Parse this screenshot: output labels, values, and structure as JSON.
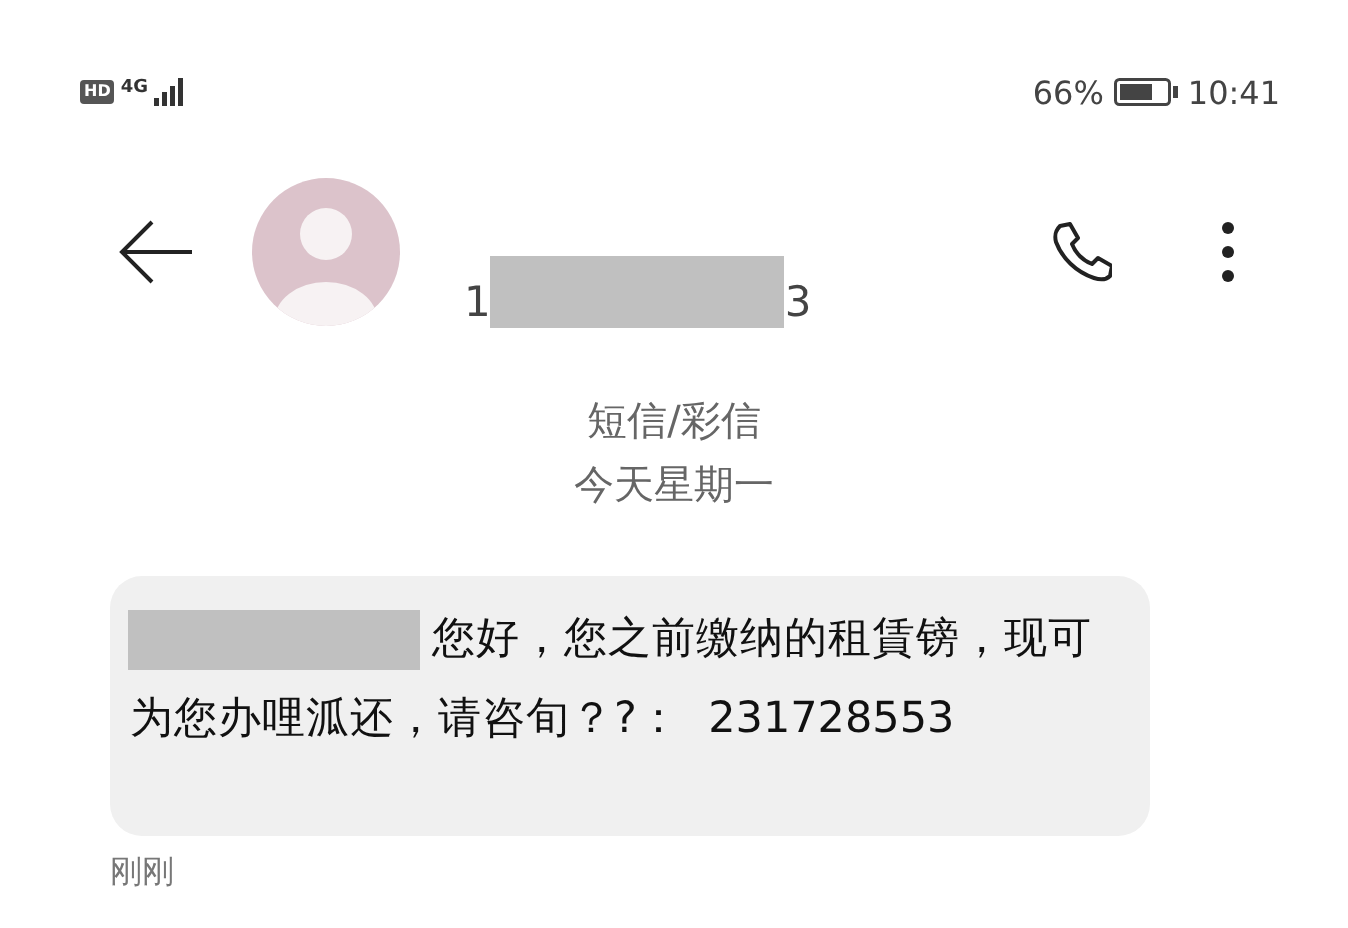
{
  "status_bar": {
    "hd": "HD",
    "network": "4G",
    "battery": "66%",
    "time": "10:41"
  },
  "header": {
    "number_start": "1",
    "number_end": "3"
  },
  "conversation": {
    "type": "短信/彩信",
    "date": "今天星期一"
  },
  "messages": [
    {
      "lines": [
        "您好，您之前缴纳的租賃镑，现可",
        "为您办哩泒还，请咨旬？?：  231728553"
      ],
      "time": "刚刚"
    }
  ]
}
